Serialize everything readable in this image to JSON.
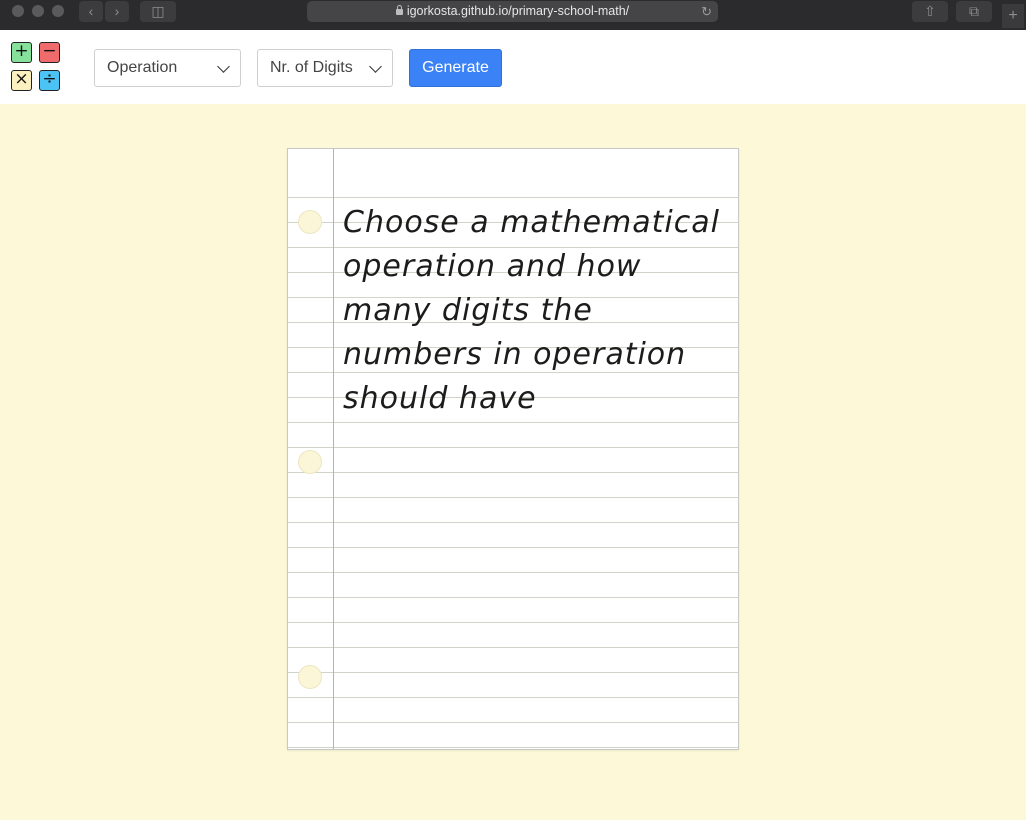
{
  "browser": {
    "url": "igorkosta.github.io/primary-school-math/"
  },
  "header": {
    "logo_symbols": [
      "+",
      "−",
      "×",
      "÷"
    ],
    "logo_colors": [
      "#86e29b",
      "#f06c6c",
      "#fcefc0",
      "#4cc3f5"
    ],
    "operation_select": "Operation",
    "digits_select": "Nr. of Digits",
    "generate_label": "Generate",
    "accent": "#3b82f6"
  },
  "paper": {
    "message": "Choose a mathematical operation and how many digits the numbers in operation should have"
  },
  "colors": {
    "page_background": "#fdf9d8"
  }
}
